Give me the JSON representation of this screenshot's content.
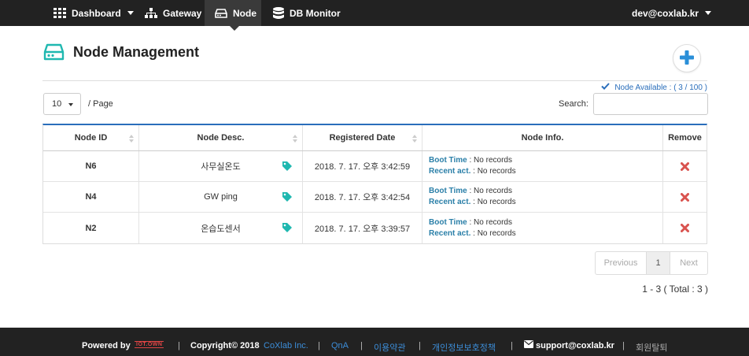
{
  "nav": {
    "items": [
      {
        "label": "Dashboard",
        "icon": "grid-icon"
      },
      {
        "label": "Gateway",
        "icon": "sitemap-icon"
      },
      {
        "label": "Node",
        "icon": "hdd-icon"
      },
      {
        "label": "DB Monitor",
        "icon": "database-icon"
      }
    ],
    "user": "dev@coxlab.kr"
  },
  "header": {
    "title": "Node Management",
    "availability": "Node Available : ( 3 / 100 )"
  },
  "controls": {
    "page_size": "10",
    "per_page_label": "/ Page",
    "search_label": "Search:",
    "search_value": ""
  },
  "table": {
    "headers": [
      "Node ID",
      "Node Desc.",
      "Registered Date",
      "Node Info.",
      "Remove"
    ],
    "boot_label": "Boot Time",
    "recent_label": "Recent act.",
    "rows": [
      {
        "id": "N6",
        "desc": "사무실온도",
        "date": "2018. 7. 17. 오후 3:42:59",
        "boot": ": No records",
        "recent": ": No records"
      },
      {
        "id": "N4",
        "desc": "GW ping",
        "date": "2018. 7. 17. 오후 3:42:54",
        "boot": ": No records",
        "recent": ": No records"
      },
      {
        "id": "N2",
        "desc": "온습도센서",
        "date": "2018. 7. 17. 오후 3:39:57",
        "boot": ": No records",
        "recent": ": No records"
      }
    ]
  },
  "pagination": {
    "prev": "Previous",
    "current": "1",
    "next": "Next",
    "summary": "1 - 3 ( Total : 3 )"
  },
  "footer": {
    "powered": "Powered by",
    "logo_text": "IOT.OWN",
    "copyright": "Copyright© 2018",
    "company": "CoXlab Inc.",
    "qna": "QnA",
    "terms": "이용약관",
    "privacy": "개인정보보호정책",
    "email": "support@coxlab.kr",
    "withdraw": "회원탈퇴",
    "separator": "|"
  },
  "colors": {
    "accent": "#2a6ebb",
    "teal": "#1fb8b0",
    "remove": "#d9534f",
    "nav_bg": "#222222"
  }
}
